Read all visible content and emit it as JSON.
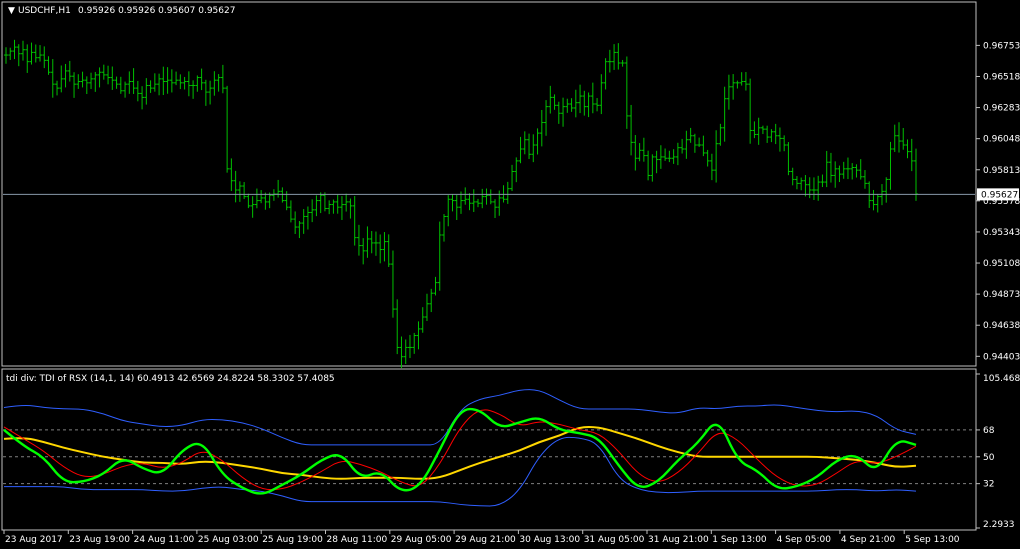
{
  "main_panel": {
    "symbol_label": "USDCHF,H1",
    "ohlc_label": "0.95926 0.95926 0.95607 0.95627",
    "current_price_label": "0.95627",
    "y_ticks": [
      "0.96753",
      "0.96518",
      "0.96283",
      "0.96048",
      "0.95813",
      "0.95578",
      "0.95343",
      "0.95108",
      "0.94873",
      "0.94638",
      "0.94403"
    ]
  },
  "sub_panel": {
    "indicator_label": "tdi div: TDI of RSX  (14,1, 14) 60.4913 42.6569 24.8224 58.3302 57.4085",
    "y_ticks": [
      "105.4682",
      "68",
      "50",
      "32",
      "2.2933"
    ]
  },
  "x_axis": {
    "labels": [
      "23 Aug 2017",
      "23 Aug 19:00",
      "24 Aug 11:00",
      "25 Aug 03:00",
      "25 Aug 19:00",
      "28 Aug 11:00",
      "29 Aug 05:00",
      "29 Aug 21:00",
      "30 Aug 13:00",
      "31 Aug 05:00",
      "31 Aug 21:00",
      "1 Sep 13:00",
      "4 Sep 05:00",
      "4 Sep 21:00",
      "5 Sep 13:00"
    ]
  },
  "colors": {
    "background": "#000000",
    "grid_axis": "#c0c0c0",
    "bars": "#00c000",
    "current_line": "#8899aa",
    "rsx_green": "#00ff00",
    "signal_red": "#ff0000",
    "band_blue": "#2f5fff",
    "midline_yellow": "#ffd700",
    "level_lines": "#808080"
  },
  "chart_data": [
    {
      "type": "bar",
      "title": "USDCHF,H1",
      "subtype": "ohlc",
      "ylim": [
        0.9436,
        0.9696
      ],
      "bars_ohlc_close_approx": [
        0.9668,
        0.9671,
        0.9674,
        0.9669,
        0.9672,
        0.9663,
        0.967,
        0.9666,
        0.9668,
        0.9664,
        0.9655,
        0.9646,
        0.9643,
        0.965,
        0.9656,
        0.9652,
        0.9646,
        0.9648,
        0.9649,
        0.9647,
        0.965,
        0.9653,
        0.9655,
        0.9653,
        0.9651,
        0.9649,
        0.9646,
        0.9641,
        0.9646,
        0.9648,
        0.9643,
        0.9639,
        0.9636,
        0.9645,
        0.9643,
        0.9646,
        0.965,
        0.9648,
        0.9649,
        0.9647,
        0.9649,
        0.9647,
        0.9648,
        0.9645,
        0.9645,
        0.9651,
        0.9647,
        0.964,
        0.9643,
        0.9649,
        0.9651,
        0.9643,
        0.9582,
        0.9573,
        0.9566,
        0.9569,
        0.9561,
        0.9554,
        0.9555,
        0.9558,
        0.956,
        0.9557,
        0.9562,
        0.9563,
        0.9565,
        0.9558,
        0.9553,
        0.9544,
        0.9538,
        0.9541,
        0.9546,
        0.9549,
        0.9551,
        0.9558,
        0.9562,
        0.9552,
        0.9555,
        0.9557,
        0.9553,
        0.9555,
        0.9557,
        0.9554,
        0.953,
        0.9524,
        0.952,
        0.9529,
        0.9526,
        0.9526,
        0.9521,
        0.9527,
        0.951,
        0.9476,
        0.9447,
        0.944,
        0.9447,
        0.9447,
        0.9456,
        0.9461,
        0.947,
        0.948,
        0.9488,
        0.9496,
        0.9532,
        0.9546,
        0.9559,
        0.9558,
        0.9553,
        0.9558,
        0.9559,
        0.9556,
        0.9557,
        0.9556,
        0.9561,
        0.9562,
        0.9557,
        0.9553,
        0.956,
        0.9559,
        0.9567,
        0.958,
        0.9588,
        0.9597,
        0.9604,
        0.9593,
        0.96,
        0.9609,
        0.9617,
        0.9629,
        0.9636,
        0.963,
        0.9624,
        0.9629,
        0.9631,
        0.9628,
        0.9632,
        0.9637,
        0.9629,
        0.9637,
        0.9631,
        0.963,
        0.9647,
        0.9663,
        0.9663,
        0.967,
        0.9662,
        0.9662,
        0.9622,
        0.9602,
        0.959,
        0.9596,
        0.9592,
        0.9577,
        0.9591,
        0.9589,
        0.9591,
        0.959,
        0.959,
        0.9591,
        0.9598,
        0.9597,
        0.9604,
        0.9607,
        0.96,
        0.96,
        0.9594,
        0.9588,
        0.9581,
        0.9601,
        0.9613,
        0.9635,
        0.9644,
        0.9647,
        0.9647,
        0.9648,
        0.9646
      ],
      "bars_ohlc_close_approx_part2": [
        0.9611,
        0.9608,
        0.9613,
        0.9612,
        0.9606,
        0.961,
        0.9607,
        0.9605,
        0.96,
        0.958,
        0.9574,
        0.9571,
        0.9573,
        0.957,
        0.9566,
        0.9566,
        0.9572,
        0.9572,
        0.9587,
        0.9577,
        0.9582,
        0.9578,
        0.9582,
        0.9582,
        0.9583,
        0.9581,
        0.9576,
        0.9571,
        0.9558,
        0.9555,
        0.9561,
        0.9565,
        0.9574,
        0.9597,
        0.9607,
        0.9603,
        0.96,
        0.9595,
        0.9588,
        0.9563
      ],
      "current_price": 0.95627
    },
    {
      "type": "line",
      "title": "tdi div: TDI of RSX  (14,1, 14) 60.4913 42.6569 24.8224 58.3302 57.4085",
      "ylim": [
        2.2933,
        105.4682
      ],
      "levels": [
        68,
        50,
        32
      ],
      "x": [
        0,
        20,
        40,
        60,
        80,
        100,
        120,
        140,
        160,
        180,
        200,
        220,
        240,
        260,
        280,
        300,
        320,
        340,
        360,
        380,
        400,
        420,
        440,
        460,
        480,
        500,
        520,
        540,
        560,
        580,
        600,
        620,
        640,
        660,
        680,
        700,
        720,
        740,
        760,
        780,
        800,
        820,
        840,
        860,
        880,
        900,
        920
      ],
      "series": [
        {
          "name": "",
          "color": "#00ff00",
          "values": [
            68,
            57,
            50,
            33,
            33,
            38,
            50,
            42,
            38,
            55,
            61,
            38,
            29,
            24,
            31,
            38,
            48,
            53,
            35,
            41,
            26,
            30,
            55,
            82,
            82,
            69,
            73,
            77,
            68,
            66,
            63,
            44,
            28,
            33,
            48,
            59,
            77,
            47,
            41,
            28,
            30,
            36,
            48,
            52,
            39,
            62,
            58
          ]
        },
        {
          "name": "",
          "color": "#ff0000",
          "values": [
            70,
            62,
            54,
            43,
            36,
            38,
            44,
            46,
            42,
            46,
            55,
            48,
            36,
            28,
            28,
            33,
            40,
            48,
            45,
            40,
            33,
            29,
            45,
            70,
            83,
            79,
            70,
            74,
            72,
            68,
            66,
            54,
            38,
            32,
            39,
            52,
            68,
            62,
            48,
            36,
            30,
            31,
            39,
            48,
            45,
            50,
            57
          ]
        },
        {
          "name": "",
          "color": "#2f5fff",
          "values": [
            83,
            85,
            83,
            82,
            82,
            79,
            74,
            72,
            70,
            71,
            75,
            75,
            73,
            69,
            63,
            58,
            58,
            58,
            58,
            58,
            58,
            58,
            58,
            82,
            89,
            91,
            95,
            95,
            88,
            82,
            82,
            82,
            82,
            80,
            79,
            83,
            82,
            84,
            84,
            85,
            83,
            81,
            80,
            81,
            78,
            68,
            65
          ]
        },
        {
          "name": "",
          "color": "#2f5fff",
          "values": [
            30,
            30,
            30,
            30,
            28,
            28,
            28,
            28,
            27,
            27,
            29,
            30,
            28,
            27,
            24,
            20,
            20,
            20,
            20,
            20,
            20,
            20,
            20,
            18,
            17,
            17,
            27,
            51,
            63,
            63,
            59,
            35,
            28,
            26,
            26,
            27,
            27,
            27,
            27,
            27,
            27,
            27,
            28,
            28,
            27,
            28,
            27
          ]
        },
        {
          "name": "",
          "color": "#ffd700",
          "values": [
            62,
            63,
            60,
            56,
            53,
            50,
            48,
            46,
            46,
            45,
            47,
            46,
            44,
            42,
            39,
            38,
            36,
            35,
            36,
            36,
            36,
            35,
            36,
            41,
            46,
            50,
            54,
            60,
            64,
            70,
            70,
            66,
            62,
            57,
            53,
            50,
            50,
            50,
            50,
            50,
            50,
            50,
            49,
            48,
            46,
            43,
            44
          ]
        }
      ]
    }
  ]
}
